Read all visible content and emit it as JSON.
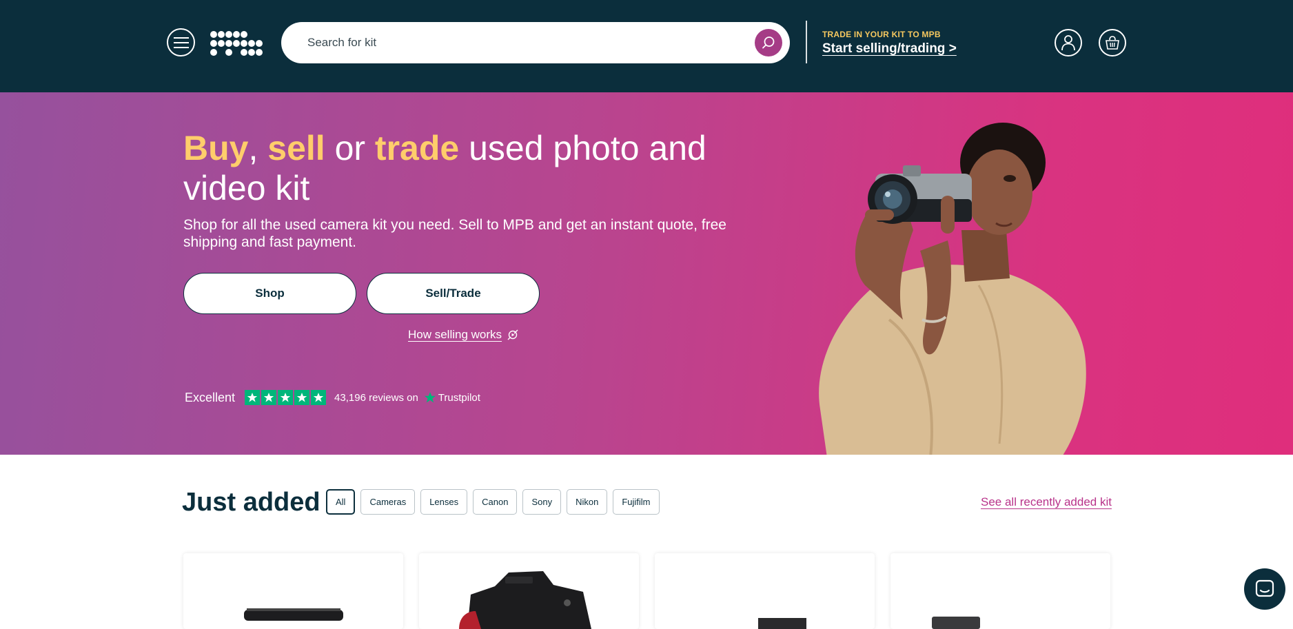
{
  "header": {
    "search_placeholder": "Search for kit",
    "trade_kicker": "TRADE IN YOUR KIT TO MPB",
    "trade_link": "Start selling/trading >",
    "icons": [
      "menu-icon",
      "mpb-logo",
      "search-icon",
      "account-icon",
      "basket-icon"
    ]
  },
  "hero": {
    "title_w1": "Buy",
    "title_sep1": ", ",
    "title_w2": "sell",
    "title_sep2": " or ",
    "title_w3": "trade",
    "title_rest": " used photo and video kit",
    "subtitle": "Shop for all the used camera kit you need. Sell to MPB and get an instant quote, free shipping and fast payment.",
    "shop_label": "Shop",
    "sell_label": "Sell/Trade",
    "how_link": "How selling works",
    "trustpilot": {
      "rating_text": "Excellent",
      "stars": 5,
      "reviews_text": "43,196 reviews on",
      "brand": "Trustpilot"
    }
  },
  "just_added": {
    "title": "Just added",
    "filters": [
      "All",
      "Cameras",
      "Lenses",
      "Canon",
      "Sony",
      "Nikon",
      "Fujifilm"
    ],
    "active_filter": "All",
    "see_all": "See all recently added kit"
  },
  "colors": {
    "header_bg": "#0b2e3c",
    "accent_yellow": "#ffcd6b",
    "accent_magenta": "#a53c86",
    "link_pink": "#b8328a",
    "trustpilot_green": "#00b67a"
  }
}
